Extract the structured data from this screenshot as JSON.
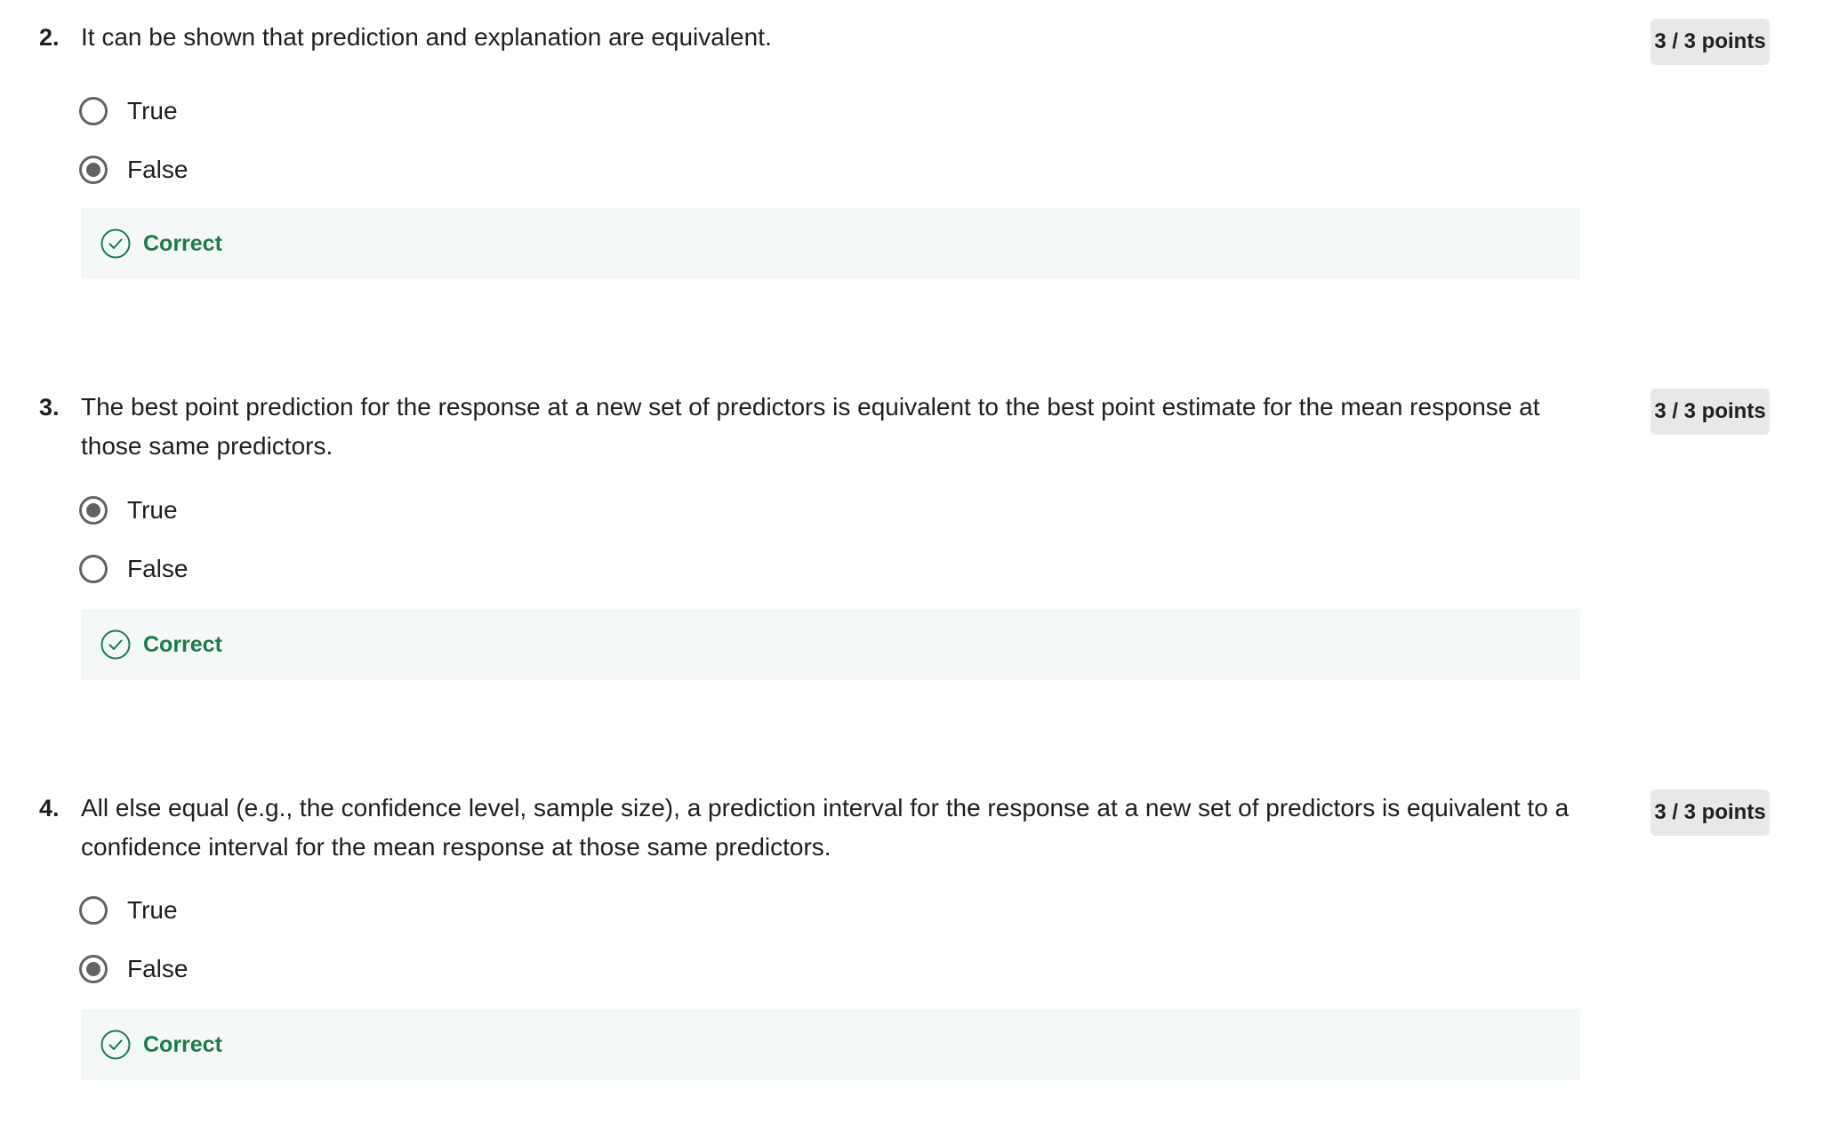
{
  "colors": {
    "badge_background": "#e8e8e8",
    "radio_border": "#636363",
    "feedback_background": "#f4f9f7",
    "correct_green": "#1f7a4d"
  },
  "icons": {
    "feedback": "check-circle-icon"
  },
  "questions": [
    {
      "number": "2.",
      "text": "It can be shown that prediction and explanation are equivalent.",
      "points": "3 / 3 points",
      "options": [
        {
          "label": "True",
          "selected": false
        },
        {
          "label": "False",
          "selected": true
        }
      ],
      "feedback": "Correct"
    },
    {
      "number": "3.",
      "text": "The best point prediction for the response at a new set of predictors is equivalent to the best point estimate for the mean response at those same predictors.",
      "points": "3 / 3 points",
      "options": [
        {
          "label": "True",
          "selected": true
        },
        {
          "label": "False",
          "selected": false
        }
      ],
      "feedback": "Correct"
    },
    {
      "number": "4.",
      "text": "All else equal (e.g., the confidence level, sample size), a prediction interval for the response at a new set of predictors is equivalent to a confidence interval for the mean response at those same predictors.",
      "points": "3 / 3 points",
      "options": [
        {
          "label": "True",
          "selected": false
        },
        {
          "label": "False",
          "selected": true
        }
      ],
      "feedback": "Correct"
    }
  ]
}
